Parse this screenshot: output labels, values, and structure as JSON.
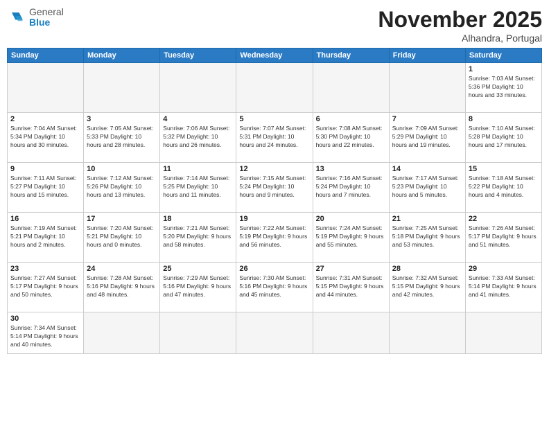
{
  "logo": {
    "general": "General",
    "blue": "Blue"
  },
  "header": {
    "month_year": "November 2025",
    "location": "Alhandra, Portugal"
  },
  "weekdays": [
    "Sunday",
    "Monday",
    "Tuesday",
    "Wednesday",
    "Thursday",
    "Friday",
    "Saturday"
  ],
  "weeks": [
    [
      {
        "day": "",
        "info": ""
      },
      {
        "day": "",
        "info": ""
      },
      {
        "day": "",
        "info": ""
      },
      {
        "day": "",
        "info": ""
      },
      {
        "day": "",
        "info": ""
      },
      {
        "day": "",
        "info": ""
      },
      {
        "day": "1",
        "info": "Sunrise: 7:03 AM\nSunset: 5:36 PM\nDaylight: 10 hours\nand 33 minutes."
      }
    ],
    [
      {
        "day": "2",
        "info": "Sunrise: 7:04 AM\nSunset: 5:34 PM\nDaylight: 10 hours\nand 30 minutes."
      },
      {
        "day": "3",
        "info": "Sunrise: 7:05 AM\nSunset: 5:33 PM\nDaylight: 10 hours\nand 28 minutes."
      },
      {
        "day": "4",
        "info": "Sunrise: 7:06 AM\nSunset: 5:32 PM\nDaylight: 10 hours\nand 26 minutes."
      },
      {
        "day": "5",
        "info": "Sunrise: 7:07 AM\nSunset: 5:31 PM\nDaylight: 10 hours\nand 24 minutes."
      },
      {
        "day": "6",
        "info": "Sunrise: 7:08 AM\nSunset: 5:30 PM\nDaylight: 10 hours\nand 22 minutes."
      },
      {
        "day": "7",
        "info": "Sunrise: 7:09 AM\nSunset: 5:29 PM\nDaylight: 10 hours\nand 19 minutes."
      },
      {
        "day": "8",
        "info": "Sunrise: 7:10 AM\nSunset: 5:28 PM\nDaylight: 10 hours\nand 17 minutes."
      }
    ],
    [
      {
        "day": "9",
        "info": "Sunrise: 7:11 AM\nSunset: 5:27 PM\nDaylight: 10 hours\nand 15 minutes."
      },
      {
        "day": "10",
        "info": "Sunrise: 7:12 AM\nSunset: 5:26 PM\nDaylight: 10 hours\nand 13 minutes."
      },
      {
        "day": "11",
        "info": "Sunrise: 7:14 AM\nSunset: 5:25 PM\nDaylight: 10 hours\nand 11 minutes."
      },
      {
        "day": "12",
        "info": "Sunrise: 7:15 AM\nSunset: 5:24 PM\nDaylight: 10 hours\nand 9 minutes."
      },
      {
        "day": "13",
        "info": "Sunrise: 7:16 AM\nSunset: 5:24 PM\nDaylight: 10 hours\nand 7 minutes."
      },
      {
        "day": "14",
        "info": "Sunrise: 7:17 AM\nSunset: 5:23 PM\nDaylight: 10 hours\nand 5 minutes."
      },
      {
        "day": "15",
        "info": "Sunrise: 7:18 AM\nSunset: 5:22 PM\nDaylight: 10 hours\nand 4 minutes."
      }
    ],
    [
      {
        "day": "16",
        "info": "Sunrise: 7:19 AM\nSunset: 5:21 PM\nDaylight: 10 hours\nand 2 minutes."
      },
      {
        "day": "17",
        "info": "Sunrise: 7:20 AM\nSunset: 5:21 PM\nDaylight: 10 hours\nand 0 minutes."
      },
      {
        "day": "18",
        "info": "Sunrise: 7:21 AM\nSunset: 5:20 PM\nDaylight: 9 hours\nand 58 minutes."
      },
      {
        "day": "19",
        "info": "Sunrise: 7:22 AM\nSunset: 5:19 PM\nDaylight: 9 hours\nand 56 minutes."
      },
      {
        "day": "20",
        "info": "Sunrise: 7:24 AM\nSunset: 5:19 PM\nDaylight: 9 hours\nand 55 minutes."
      },
      {
        "day": "21",
        "info": "Sunrise: 7:25 AM\nSunset: 5:18 PM\nDaylight: 9 hours\nand 53 minutes."
      },
      {
        "day": "22",
        "info": "Sunrise: 7:26 AM\nSunset: 5:17 PM\nDaylight: 9 hours\nand 51 minutes."
      }
    ],
    [
      {
        "day": "23",
        "info": "Sunrise: 7:27 AM\nSunset: 5:17 PM\nDaylight: 9 hours\nand 50 minutes."
      },
      {
        "day": "24",
        "info": "Sunrise: 7:28 AM\nSunset: 5:16 PM\nDaylight: 9 hours\nand 48 minutes."
      },
      {
        "day": "25",
        "info": "Sunrise: 7:29 AM\nSunset: 5:16 PM\nDaylight: 9 hours\nand 47 minutes."
      },
      {
        "day": "26",
        "info": "Sunrise: 7:30 AM\nSunset: 5:16 PM\nDaylight: 9 hours\nand 45 minutes."
      },
      {
        "day": "27",
        "info": "Sunrise: 7:31 AM\nSunset: 5:15 PM\nDaylight: 9 hours\nand 44 minutes."
      },
      {
        "day": "28",
        "info": "Sunrise: 7:32 AM\nSunset: 5:15 PM\nDaylight: 9 hours\nand 42 minutes."
      },
      {
        "day": "29",
        "info": "Sunrise: 7:33 AM\nSunset: 5:14 PM\nDaylight: 9 hours\nand 41 minutes."
      }
    ],
    [
      {
        "day": "30",
        "info": "Sunrise: 7:34 AM\nSunset: 5:14 PM\nDaylight: 9 hours\nand 40 minutes."
      },
      {
        "day": "",
        "info": ""
      },
      {
        "day": "",
        "info": ""
      },
      {
        "day": "",
        "info": ""
      },
      {
        "day": "",
        "info": ""
      },
      {
        "day": "",
        "info": ""
      },
      {
        "day": "",
        "info": ""
      }
    ]
  ]
}
